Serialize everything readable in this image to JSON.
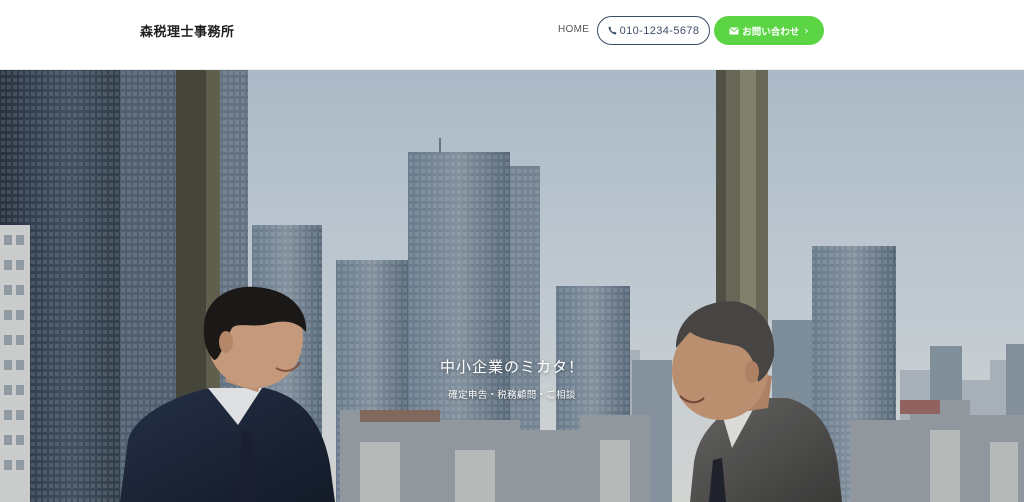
{
  "header": {
    "logo": "森税理士事務所",
    "nav_home": "HOME",
    "phone": "010-1234-5678",
    "contact": "お問い合わせ",
    "contact_chevron": "›"
  },
  "hero": {
    "title": "中小企業のミカタ！",
    "subtitle": "確定申告・税務顧問・ご相談"
  },
  "colors": {
    "accent_green": "#5cd545",
    "navy": "#3e4e68"
  },
  "icons": {
    "phone": "phone-icon",
    "mail": "mail-icon",
    "chevron": "chevron-right-icon"
  }
}
